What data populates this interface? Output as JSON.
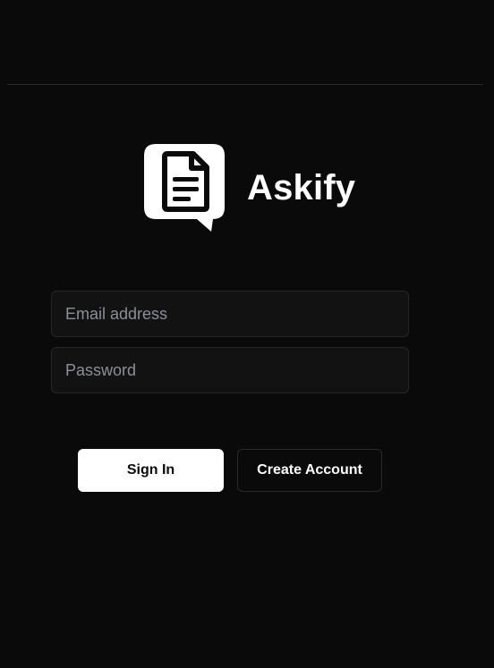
{
  "brand": {
    "name": "Askify",
    "logo_icon": "document-chat-icon",
    "logo_bg_color": "#ffffff",
    "logo_fg_color": "#0a0a0a"
  },
  "form": {
    "email": {
      "value": "",
      "placeholder": "Email address"
    },
    "password": {
      "value": "",
      "placeholder": "Password"
    }
  },
  "actions": {
    "sign_in_label": "Sign In",
    "create_account_label": "Create Account"
  },
  "colors": {
    "background": "#0a0a0a",
    "field_background": "#121212",
    "field_border": "#262626",
    "primary_button": "#ffffff"
  }
}
